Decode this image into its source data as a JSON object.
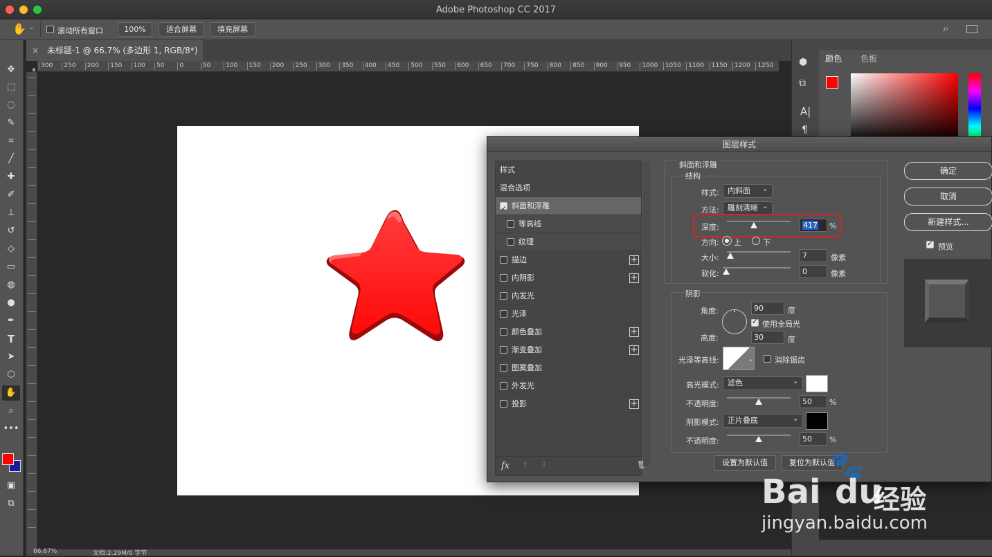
{
  "window": {
    "title": "Adobe Photoshop CC 2017"
  },
  "optbar": {
    "scroll_all_label": "滚动所有窗口",
    "zoom_btn": "100%",
    "fit_btn": "适合屏幕",
    "fill_btn": "填充屏幕"
  },
  "doc_tab": {
    "title": "未标题-1 @ 66.7% (多边形 1, RGB/8*) *",
    "close": "×"
  },
  "ruler_h": [
    "300",
    "250",
    "200",
    "150",
    "100",
    "50",
    "0",
    "50",
    "100",
    "150",
    "200",
    "250",
    "300",
    "350",
    "400",
    "450",
    "500",
    "550",
    "600",
    "650",
    "700",
    "750",
    "800",
    "850",
    "900",
    "950",
    "1000",
    "1050",
    "1100",
    "1150",
    "1200",
    "1250"
  ],
  "status": {
    "zoom": "66.67%",
    "doc": "文档:2.29M/0 字节"
  },
  "colors": {
    "foreground": "#ff0000",
    "background": "#1a1aa0",
    "star": "#ff0a0a",
    "highlight_box": "#e02020"
  },
  "color_panel": {
    "tab_color": "颜色",
    "tab_swatch": "色板"
  },
  "dialog": {
    "title": "图层样式",
    "list": {
      "styles": "样式",
      "blend": "混合选项",
      "items": [
        {
          "label": "斜面和浮雕",
          "checked": true,
          "plus": false,
          "indent": false,
          "selected": true
        },
        {
          "label": "等高线",
          "checked": false,
          "plus": false,
          "indent": true
        },
        {
          "label": "纹理",
          "checked": false,
          "plus": false,
          "indent": true
        },
        {
          "label": "描边",
          "checked": false,
          "plus": true,
          "indent": false
        },
        {
          "label": "内阴影",
          "checked": false,
          "plus": true,
          "indent": false
        },
        {
          "label": "内发光",
          "checked": false,
          "plus": false,
          "indent": false
        },
        {
          "label": "光泽",
          "checked": false,
          "plus": false,
          "indent": false
        },
        {
          "label": "颜色叠加",
          "checked": false,
          "plus": true,
          "indent": false
        },
        {
          "label": "渐变叠加",
          "checked": false,
          "plus": true,
          "indent": false
        },
        {
          "label": "图案叠加",
          "checked": false,
          "plus": false,
          "indent": false
        },
        {
          "label": "外发光",
          "checked": false,
          "plus": false,
          "indent": false
        },
        {
          "label": "投影",
          "checked": false,
          "plus": true,
          "indent": false
        }
      ],
      "fx": "fx"
    },
    "bevel": {
      "section": "斜面和浮雕",
      "structure": "结构",
      "style_label": "样式:",
      "style_value": "内斜面",
      "method_label": "方法:",
      "method_value": "雕刻清晰",
      "depth_label": "深度:",
      "depth_value": "417",
      "depth_unit": "%",
      "direction_label": "方向:",
      "dir_up": "上",
      "dir_down": "下",
      "size_label": "大小:",
      "size_value": "7",
      "size_unit": "像素",
      "soften_label": "软化:",
      "soften_value": "0",
      "soften_unit": "像素"
    },
    "shading": {
      "section": "阴影",
      "angle_label": "角度:",
      "angle_value": "90",
      "angle_unit": "度",
      "global_light": "使用全局光",
      "altitude_label": "高度:",
      "altitude_value": "30",
      "altitude_unit": "度",
      "gloss_label": "光泽等高线:",
      "antialias": "消除锯齿",
      "highlight_mode_label": "高光模式:",
      "highlight_mode": "滤色",
      "opacity_label": "不透明度:",
      "highlight_opacity": "50",
      "shadow_opacity": "50",
      "pct": "%",
      "shadow_mode_label": "阴影模式:",
      "shadow_mode": "正片叠底"
    },
    "buttons": {
      "ok": "确定",
      "cancel": "取消",
      "new_style": "新建样式...",
      "preview": "预览",
      "make_default": "设置为默认值",
      "reset_default": "复位为默认值"
    }
  },
  "watermark": {
    "brand": "Bai",
    "brand2": "du",
    "jy": "经验",
    "url": "jingyan.baidu.com"
  }
}
